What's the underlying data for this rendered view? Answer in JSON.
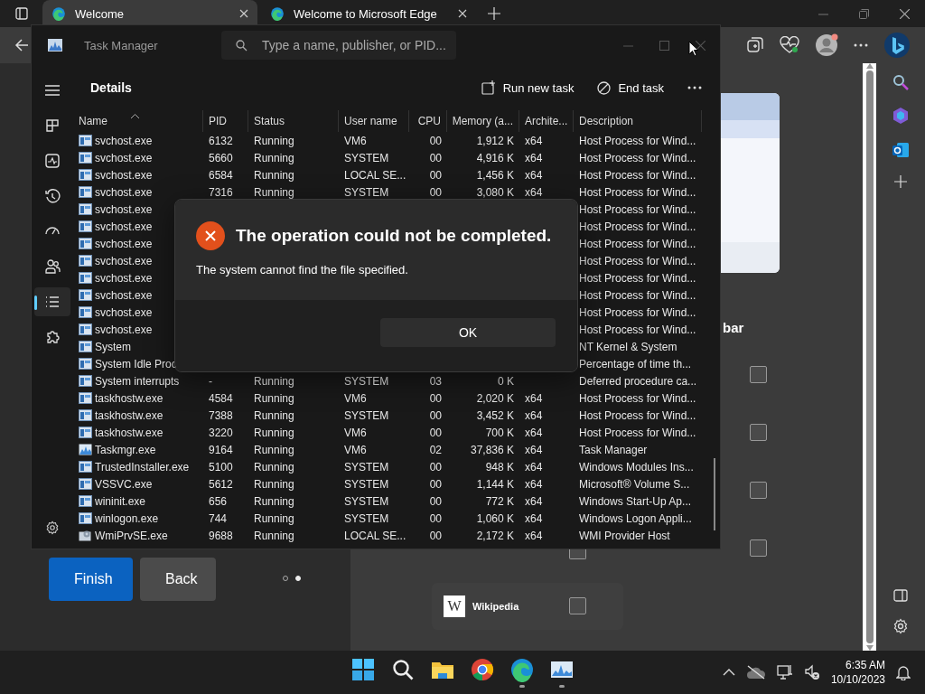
{
  "browser": {
    "tabs": [
      {
        "title": "Welcome",
        "selected": true
      },
      {
        "title": "Welcome to Microsoft Edge",
        "selected": false
      }
    ],
    "page": {
      "heading_fragment": "bar",
      "buttons": [
        {
          "label": "Finish",
          "kind": "primary"
        },
        {
          "label": "Back",
          "kind": "secondary"
        }
      ],
      "pager": [
        {
          "selected": false
        },
        {
          "selected": true
        }
      ],
      "checkboxes": [
        {
          "checked": false
        },
        {
          "checked": false
        },
        {
          "checked": false
        },
        {
          "checked": false
        },
        {
          "checked": false
        },
        {
          "checked": false
        }
      ],
      "tile": {
        "logo_text": "W",
        "label": "Wikipedia"
      }
    }
  },
  "task_manager": {
    "title": "Task Manager",
    "search": {
      "placeholder": "Type a name, publisher, or PID..."
    },
    "nav": [
      {
        "selected": false
      },
      {
        "selected": false
      },
      {
        "selected": false
      },
      {
        "selected": false
      },
      {
        "selected": false
      },
      {
        "selected": true
      },
      {
        "selected": false
      }
    ],
    "page_title": "Details",
    "actions": [
      "Run new task",
      "End task"
    ],
    "columns": [
      "Name",
      "PID",
      "Status",
      "User name",
      "CPU",
      "Memory (a...",
      "Archite...",
      "Description"
    ],
    "rows": [
      {
        "kind": "window",
        "name": "svchost.exe",
        "pid": "6132",
        "status": "Running",
        "user": "VM6",
        "cpu": "00",
        "memory": "1,912 K",
        "arch": "x64",
        "description": "Host Process for Wind..."
      },
      {
        "kind": "window",
        "name": "svchost.exe",
        "pid": "5660",
        "status": "Running",
        "user": "SYSTEM",
        "cpu": "00",
        "memory": "4,916 K",
        "arch": "x64",
        "description": "Host Process for Wind..."
      },
      {
        "kind": "window",
        "name": "svchost.exe",
        "pid": "6584",
        "status": "Running",
        "user": "LOCAL SE...",
        "cpu": "00",
        "memory": "1,456 K",
        "arch": "x64",
        "description": "Host Process for Wind..."
      },
      {
        "kind": "window",
        "name": "svchost.exe",
        "pid": "7316",
        "status": "Running",
        "user": "SYSTEM",
        "cpu": "00",
        "memory": "3,080 K",
        "arch": "x64",
        "description": "Host Process for Wind..."
      },
      {
        "kind": "window",
        "name": "svchost.exe",
        "description": "Host Process for Wind..."
      },
      {
        "kind": "window",
        "name": "svchost.exe",
        "description": "Host Process for Wind..."
      },
      {
        "kind": "window",
        "name": "svchost.exe",
        "description": "Host Process for Wind..."
      },
      {
        "kind": "window",
        "name": "svchost.exe",
        "description": "Host Process for Wind..."
      },
      {
        "kind": "window",
        "name": "svchost.exe",
        "description": "Host Process for Wind..."
      },
      {
        "kind": "window",
        "name": "svchost.exe",
        "description": "Host Process for Wind..."
      },
      {
        "kind": "window",
        "name": "svchost.exe",
        "description": "Host Process for Wind..."
      },
      {
        "kind": "window",
        "name": "svchost.exe",
        "description": "Host Process for Wind..."
      },
      {
        "kind": "window",
        "name": "System",
        "description": "NT Kernel & System"
      },
      {
        "kind": "window",
        "name": "System Idle Proc",
        "description": "Percentage of time th..."
      },
      {
        "kind": "window",
        "name": "System interrupts",
        "pid": "-",
        "status": "Running",
        "user": "SYSTEM",
        "cpu": "03",
        "memory": "0 K",
        "description": "Deferred procedure ca..."
      },
      {
        "kind": "window",
        "name": "taskhostw.exe",
        "pid": "4584",
        "status": "Running",
        "user": "VM6",
        "cpu": "00",
        "memory": "2,020 K",
        "arch": "x64",
        "description": "Host Process for Wind..."
      },
      {
        "kind": "window",
        "name": "taskhostw.exe",
        "pid": "7388",
        "status": "Running",
        "user": "SYSTEM",
        "cpu": "00",
        "memory": "3,452 K",
        "arch": "x64",
        "description": "Host Process for Wind..."
      },
      {
        "kind": "window",
        "name": "taskhostw.exe",
        "pid": "3220",
        "status": "Running",
        "user": "VM6",
        "cpu": "00",
        "memory": "700 K",
        "arch": "x64",
        "description": "Host Process for Wind..."
      },
      {
        "kind": "chart",
        "name": "Taskmgr.exe",
        "pid": "9164",
        "status": "Running",
        "user": "VM6",
        "cpu": "02",
        "memory": "37,836 K",
        "arch": "x64",
        "description": "Task Manager"
      },
      {
        "kind": "window",
        "name": "TrustedInstaller.exe",
        "pid": "5100",
        "status": "Running",
        "user": "SYSTEM",
        "cpu": "00",
        "memory": "948 K",
        "arch": "x64",
        "description": "Windows Modules Ins..."
      },
      {
        "kind": "window",
        "name": "VSSVC.exe",
        "pid": "5612",
        "status": "Running",
        "user": "SYSTEM",
        "cpu": "00",
        "memory": "1,144 K",
        "arch": "x64",
        "description": "Microsoft® Volume S..."
      },
      {
        "kind": "window",
        "name": "wininit.exe",
        "pid": "656",
        "status": "Running",
        "user": "SYSTEM",
        "cpu": "00",
        "memory": "772 K",
        "arch": "x64",
        "description": "Windows Start-Up Ap..."
      },
      {
        "kind": "window",
        "name": "winlogon.exe",
        "pid": "744",
        "status": "Running",
        "user": "SYSTEM",
        "cpu": "00",
        "memory": "1,060 K",
        "arch": "x64",
        "description": "Windows Logon Appli..."
      },
      {
        "kind": "gear",
        "name": "WmiPrvSE.exe",
        "pid": "9688",
        "status": "Running",
        "user": "LOCAL SE...",
        "cpu": "00",
        "memory": "2,172 K",
        "arch": "x64",
        "description": "WMI Provider Host"
      }
    ]
  },
  "dialog": {
    "title": "The operation could not be completed.",
    "message": "The system cannot find the file specified.",
    "button": "OK"
  },
  "taskbar": {
    "apps": [
      {
        "running": false
      },
      {
        "running": false
      },
      {
        "running": false
      },
      {
        "running": false
      },
      {
        "running": true
      },
      {
        "running": true
      }
    ],
    "time": "6:35 AM",
    "date": "10/10/2023"
  }
}
